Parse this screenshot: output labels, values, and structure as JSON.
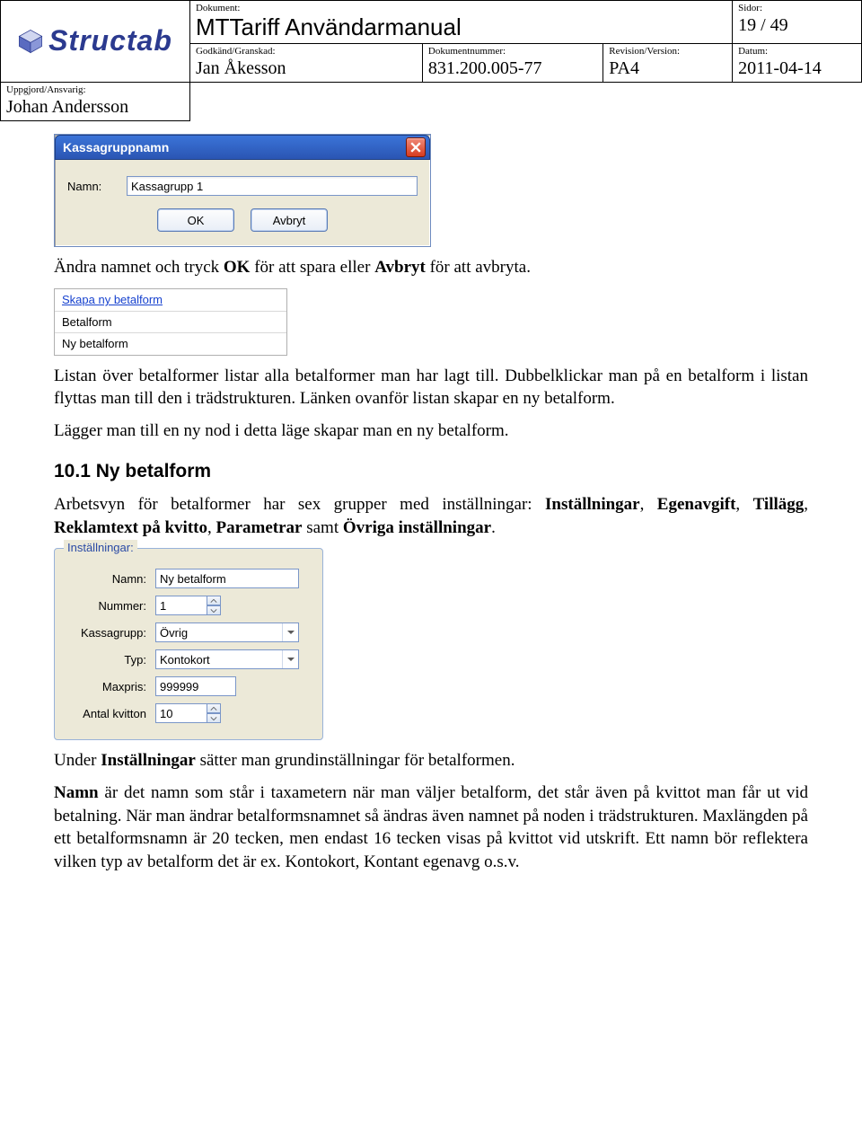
{
  "header": {
    "logo_text": "Structab",
    "dokument_lbl": "Dokument:",
    "dokument_val": "MTTariff Användarmanual",
    "sidor_lbl": "Sidor:",
    "sidor_val": "19 / 49",
    "uppgjord_lbl": "Uppgjord/Ansvarig:",
    "uppgjord_val": "Johan Andersson",
    "godkand_lbl": "Godkänd/Granskad:",
    "godkand_val": "Jan Åkesson",
    "doknr_lbl": "Dokumentnummer:",
    "doknr_val": "831.200.005-77",
    "rev_lbl": "Revision/Version:",
    "rev_val": "PA4",
    "datum_lbl": "Datum:",
    "datum_val": "2011-04-14"
  },
  "dialog1": {
    "title": "Kassagruppnamn",
    "name_label": "Namn:",
    "name_value": "Kassagrupp 1",
    "ok": "OK",
    "cancel": "Avbryt"
  },
  "para1_a": "Ändra namnet och tryck ",
  "para1_b": "OK",
  "para1_c": " för att spara eller ",
  "para1_d": "Avbryt",
  "para1_e": " för att avbryta.",
  "listbox": {
    "link": "Skapa ny betalform",
    "items": [
      "Betalform",
      "Ny betalform"
    ]
  },
  "para2": "Listan över betalformer listar alla betalformer man har lagt till. Dubbelklickar man på en betalform i listan flyttas man till den i trädstrukturen. Länken ovanför listan skapar en ny betalform.",
  "para3": "Lägger man till en ny nod i detta läge skapar man en ny betalform.",
  "heading": "10.1 Ny betalform",
  "para4_a": "Arbetsvyn för betalformer har sex grupper med inställningar: ",
  "para4_g1": "Inställningar",
  "para4_s1": ", ",
  "para4_g2": "Egenavgift",
  "para4_s2": ", ",
  "para4_g3": "Tillägg",
  "para4_s3": ", ",
  "para4_g4": "Reklamtext på kvitto",
  "para4_s4": ", ",
  "para4_g5": "Parametrar",
  "para4_s5": " samt ",
  "para4_g6": "Övriga inställningar",
  "para4_end": ".",
  "fieldset": {
    "legend": "Inställningar:",
    "namn_lbl": "Namn:",
    "namn_val": "Ny betalform",
    "nummer_lbl": "Nummer:",
    "nummer_val": "1",
    "kassagrupp_lbl": "Kassagrupp:",
    "kassagrupp_val": "Övrig",
    "typ_lbl": "Typ:",
    "typ_val": "Kontokort",
    "maxpris_lbl": "Maxpris:",
    "maxpris_val": "999999",
    "antal_lbl": "Antal kvitton",
    "antal_val": "10"
  },
  "para5_a": "Under ",
  "para5_b": "Inställningar",
  "para5_c": " sätter man grundinställningar för betalformen.",
  "para6_a": "Namn",
  "para6_b": " är det namn som står i taxametern när man väljer betalform, det står även på kvittot man får ut vid betalning. När man ändrar betalformsnamnet så ändras även namnet på noden i trädstrukturen. Maxlängden på ett betalformsnamn är 20 tecken, men endast 16 tecken visas på kvittot vid utskrift. Ett namn bör reflektera vilken typ av betalform det är ex. Kontokort, Kontant egenavg o.s.v."
}
